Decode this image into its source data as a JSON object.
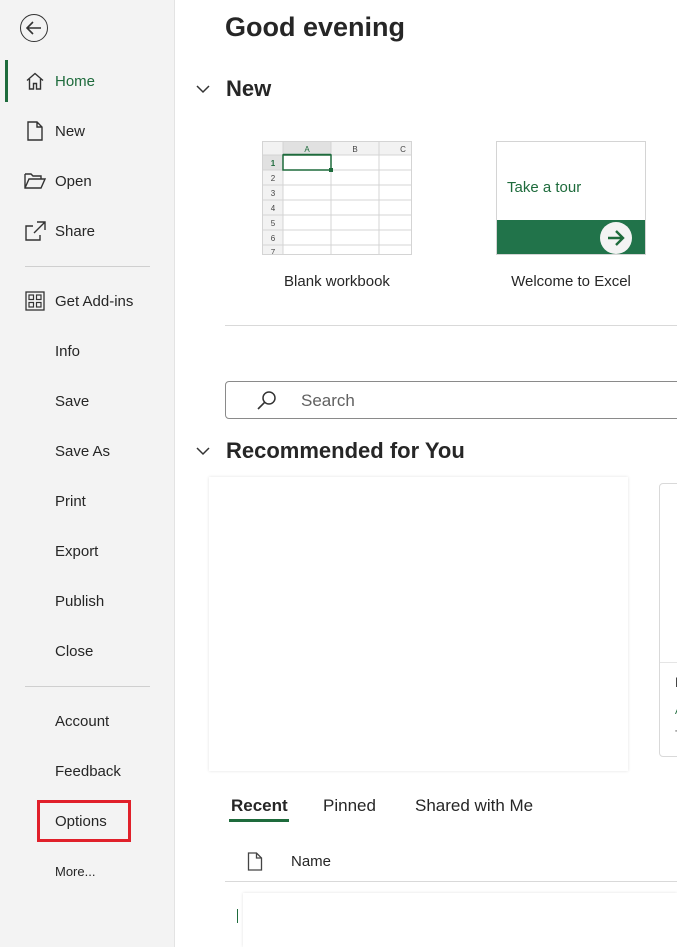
{
  "sidebar": {
    "top": [
      {
        "id": "home",
        "label": "Home",
        "icon": "home-icon",
        "active": true
      },
      {
        "id": "new",
        "label": "New",
        "icon": "new-document-icon"
      },
      {
        "id": "open",
        "label": "Open",
        "icon": "folder-open-icon"
      },
      {
        "id": "share",
        "label": "Share",
        "icon": "share-icon"
      }
    ],
    "middle": [
      {
        "id": "get-add-ins",
        "label": "Get Add-ins",
        "icon": "grid-add-ins-icon"
      },
      {
        "id": "info",
        "label": "Info"
      },
      {
        "id": "save",
        "label": "Save"
      },
      {
        "id": "save-as",
        "label": "Save As"
      },
      {
        "id": "print",
        "label": "Print"
      },
      {
        "id": "export",
        "label": "Export"
      },
      {
        "id": "publish",
        "label": "Publish"
      },
      {
        "id": "close",
        "label": "Close"
      }
    ],
    "bottom": [
      {
        "id": "account",
        "label": "Account"
      },
      {
        "id": "feedback",
        "label": "Feedback"
      },
      {
        "id": "options",
        "label": "Options",
        "highlighted": true
      },
      {
        "id": "more",
        "label": "More..."
      }
    ]
  },
  "main": {
    "greeting": "Good evening",
    "new_section": {
      "title": "New",
      "templates": [
        {
          "label": "Blank workbook",
          "columns": [
            "A",
            "B",
            "C"
          ],
          "rows": [
            "1",
            "2",
            "3",
            "4",
            "5",
            "6",
            "7"
          ]
        },
        {
          "label": "Welcome to Excel",
          "tour_text": "Take a tour",
          "icon": "arrow-right-icon"
        }
      ]
    },
    "search": {
      "placeholder": "Search"
    },
    "recommended": {
      "title": "Recommended for You",
      "card2_fragments": [
        "D",
        "A",
        "T"
      ]
    },
    "tabs": [
      {
        "label": "Recent",
        "active": true
      },
      {
        "label": "Pinned"
      },
      {
        "label": "Shared with Me"
      }
    ],
    "file_list": {
      "name_header": "Name"
    }
  },
  "colors": {
    "accent": "#1e6b3c",
    "highlight": "#e0202a",
    "tour_band": "#21734a"
  }
}
